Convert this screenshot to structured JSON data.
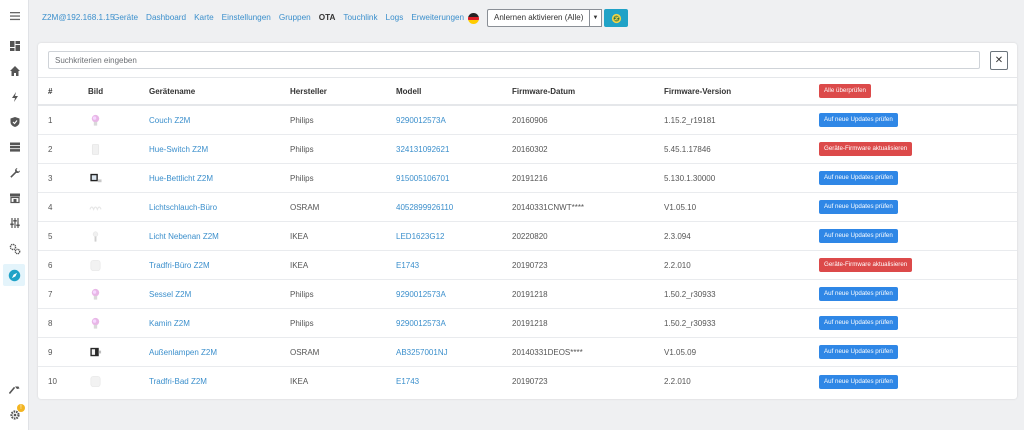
{
  "header": {
    "brand": "Z2M@192.168.1.15",
    "nav": [
      "Geräte",
      "Dashboard",
      "Karte",
      "Einstellungen",
      "Gruppen",
      "OTA",
      "Touchlink",
      "Logs",
      "Erweiterungen"
    ],
    "active_nav": "OTA",
    "permit_join_label": "Anlernen aktivieren (Alle)"
  },
  "search": {
    "placeholder": "Suchkriterien eingeben"
  },
  "table": {
    "headers": [
      "#",
      "Bild",
      "Gerätename",
      "Hersteller",
      "Modell",
      "Firmware-Datum",
      "Firmware-Version"
    ],
    "check_all_label": "Alle überprüfen",
    "rows": [
      {
        "num": "1",
        "name": "Couch Z2M",
        "vendor": "Philips",
        "model": "9290012573A",
        "date": "20160906",
        "version": "1.15.2_r19181",
        "action": "Auf neue Updates prüfen",
        "action_type": "check",
        "thumb": "color-bulb"
      },
      {
        "num": "2",
        "name": "Hue-Switch Z2M",
        "vendor": "Philips",
        "model": "324131092621",
        "date": "20160302",
        "version": "5.45.1.17846",
        "action": "Geräte-Firmware aktualisieren",
        "action_type": "update",
        "thumb": "switch"
      },
      {
        "num": "3",
        "name": "Hue-Bettlicht Z2M",
        "vendor": "Philips",
        "model": "915005106701",
        "date": "20191216",
        "version": "5.130.1.30000",
        "action": "Auf neue Updates prüfen",
        "action_type": "check",
        "thumb": "lamp"
      },
      {
        "num": "4",
        "name": "Lichtschlauch-Büro",
        "vendor": "OSRAM",
        "model": "4052899926110",
        "date": "20140331CNWT****",
        "version": "V1.05.10",
        "action": "Auf neue Updates prüfen",
        "action_type": "check",
        "thumb": "strip"
      },
      {
        "num": "5",
        "name": "Licht Nebenan Z2M",
        "vendor": "IKEA",
        "model": "LED1623G12",
        "date": "20220820",
        "version": "2.3.094",
        "action": "Auf neue Updates prüfen",
        "action_type": "check",
        "thumb": "white-bulb"
      },
      {
        "num": "6",
        "name": "Tradfri-Büro Z2M",
        "vendor": "IKEA",
        "model": "E1743",
        "date": "20190723",
        "version": "2.2.010",
        "action": "Geräte-Firmware aktualisieren",
        "action_type": "update",
        "thumb": "remote"
      },
      {
        "num": "7",
        "name": "Sessel Z2M",
        "vendor": "Philips",
        "model": "9290012573A",
        "date": "20191218",
        "version": "1.50.2_r30933",
        "action": "Auf neue Updates prüfen",
        "action_type": "check",
        "thumb": "color-bulb"
      },
      {
        "num": "8",
        "name": "Kamin Z2M",
        "vendor": "Philips",
        "model": "9290012573A",
        "date": "20191218",
        "version": "1.50.2_r30933",
        "action": "Auf neue Updates prüfen",
        "action_type": "check",
        "thumb": "color-bulb"
      },
      {
        "num": "9",
        "name": "Außenlampen Z2M",
        "vendor": "OSRAM",
        "model": "AB3257001NJ",
        "date": "20140331DEOS****",
        "version": "V1.05.09",
        "action": "Auf neue Updates prüfen",
        "action_type": "check",
        "thumb": "plug"
      },
      {
        "num": "10",
        "name": "Tradfri-Bad Z2M",
        "vendor": "IKEA",
        "model": "E1743",
        "date": "20190723",
        "version": "2.2.010",
        "action": "Auf neue Updates prüfen",
        "action_type": "check",
        "thumb": "remote"
      }
    ]
  },
  "sidebar": {
    "icons": [
      "menu-icon",
      "dashboard-icon",
      "home-icon",
      "bolt-icon",
      "shield-icon",
      "server-icon",
      "wrench-icon",
      "store-icon",
      "sliders-icon",
      "cogs-icon",
      "compass-icon",
      "hammer-icon",
      "settings-icon"
    ],
    "settings_badge": "!"
  },
  "colors": {
    "link": "#3b8fcc",
    "primary": "#2f87e6",
    "danger": "#dc4a4a",
    "accent": "#20a2c7"
  }
}
